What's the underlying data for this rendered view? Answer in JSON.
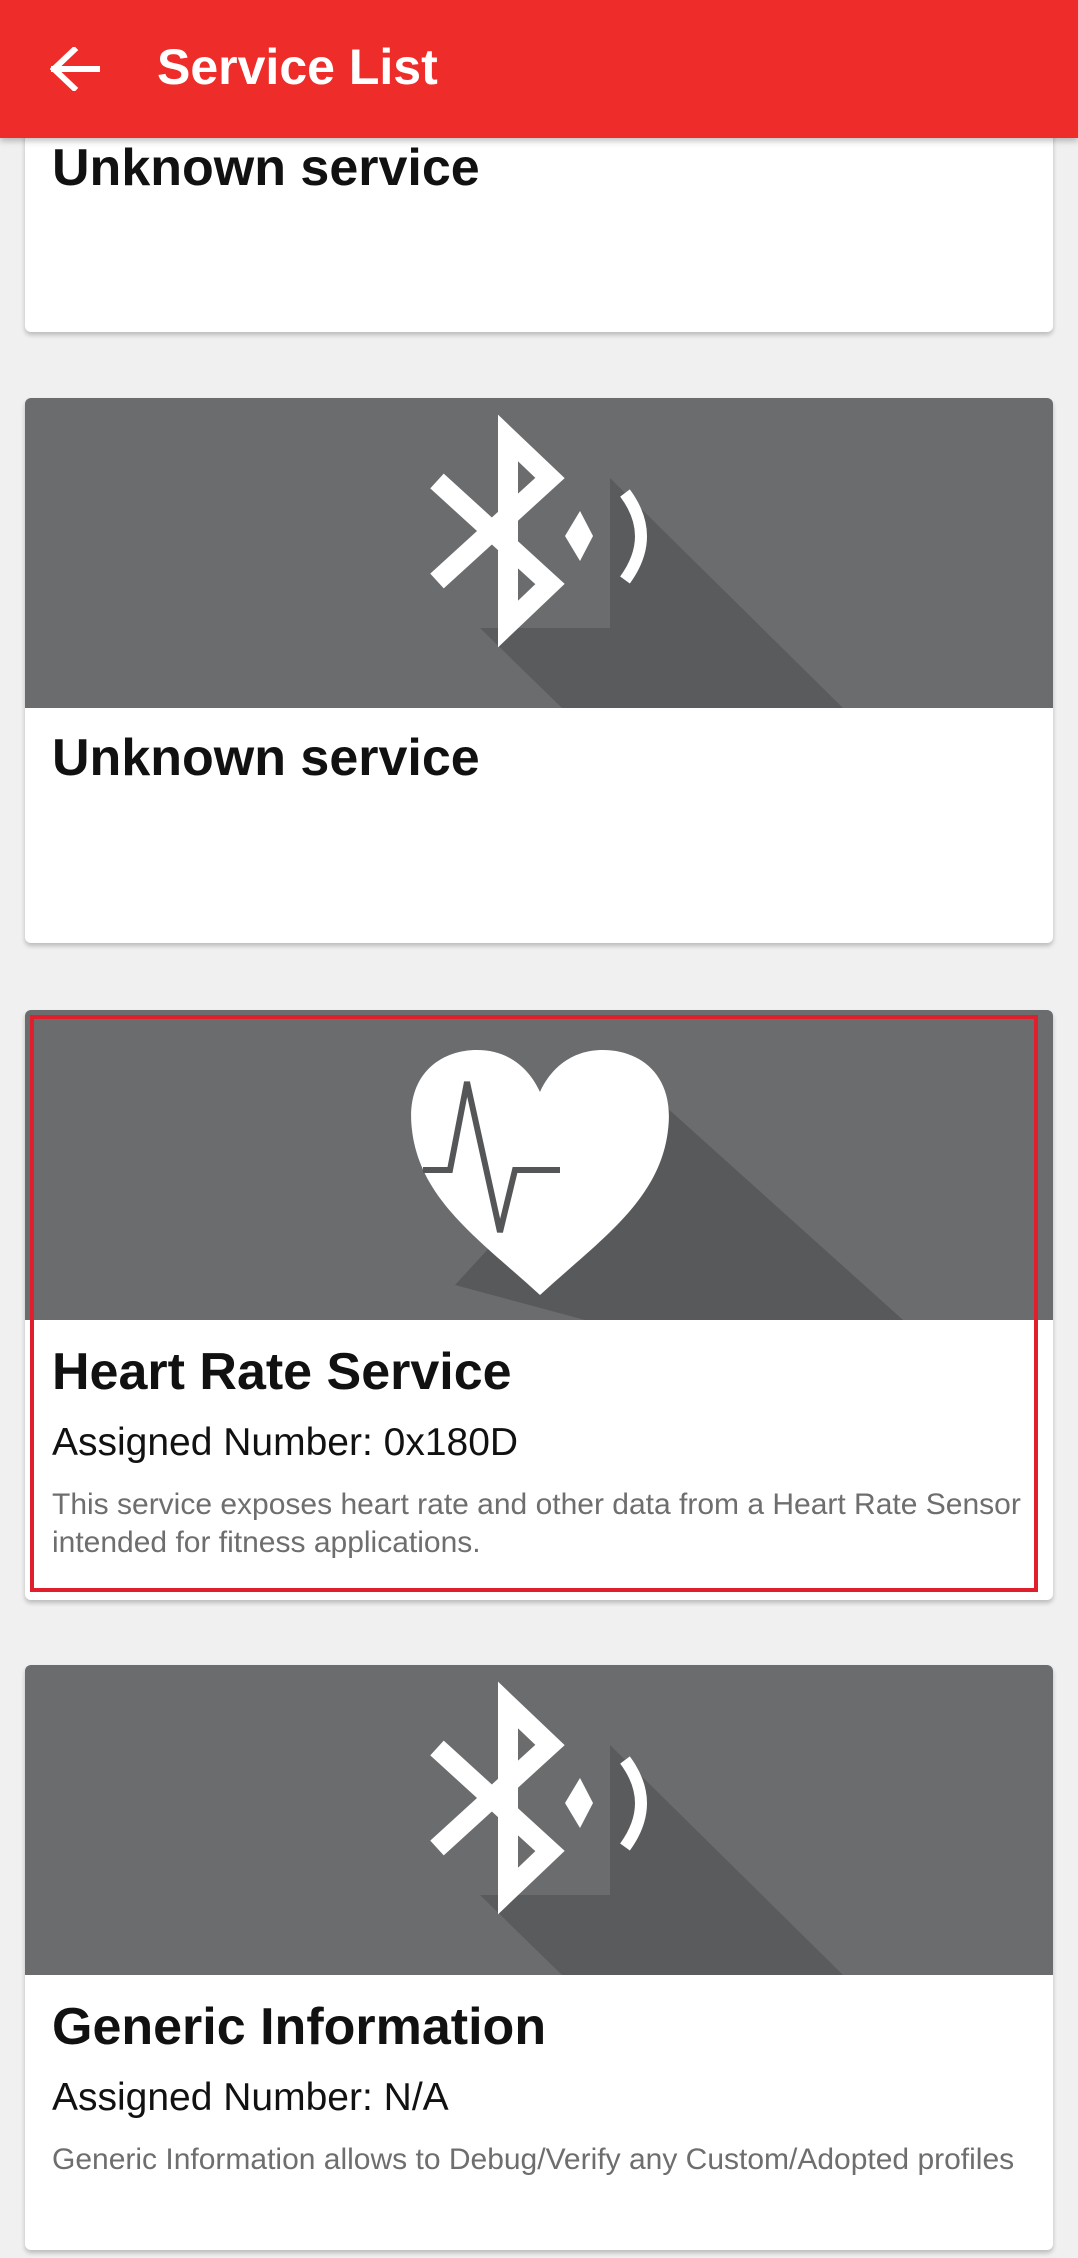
{
  "appbar": {
    "title": "Service List",
    "back_icon": "arrow-left-icon",
    "color": "#ee2d2a"
  },
  "services": [
    {
      "name": "Unknown service",
      "icon": "bluetooth-icon"
    },
    {
      "name": "Unknown service",
      "icon": "bluetooth-icon"
    },
    {
      "name": "Heart Rate Service",
      "assigned_number": "Assigned Number: 0x180D",
      "description": "This service exposes heart rate and other data from a Heart Rate Sensor intended for fitness applications.",
      "icon": "heart-rate-icon",
      "highlighted": true
    },
    {
      "name": "Generic Information",
      "assigned_number": "Assigned Number: N/A",
      "description": "Generic Information allows to Debug/Verify any Custom/Adopted profiles",
      "icon": "bluetooth-icon"
    }
  ],
  "colors": {
    "banner": "#6b6c6e",
    "highlight_border": "#e01f2d"
  }
}
